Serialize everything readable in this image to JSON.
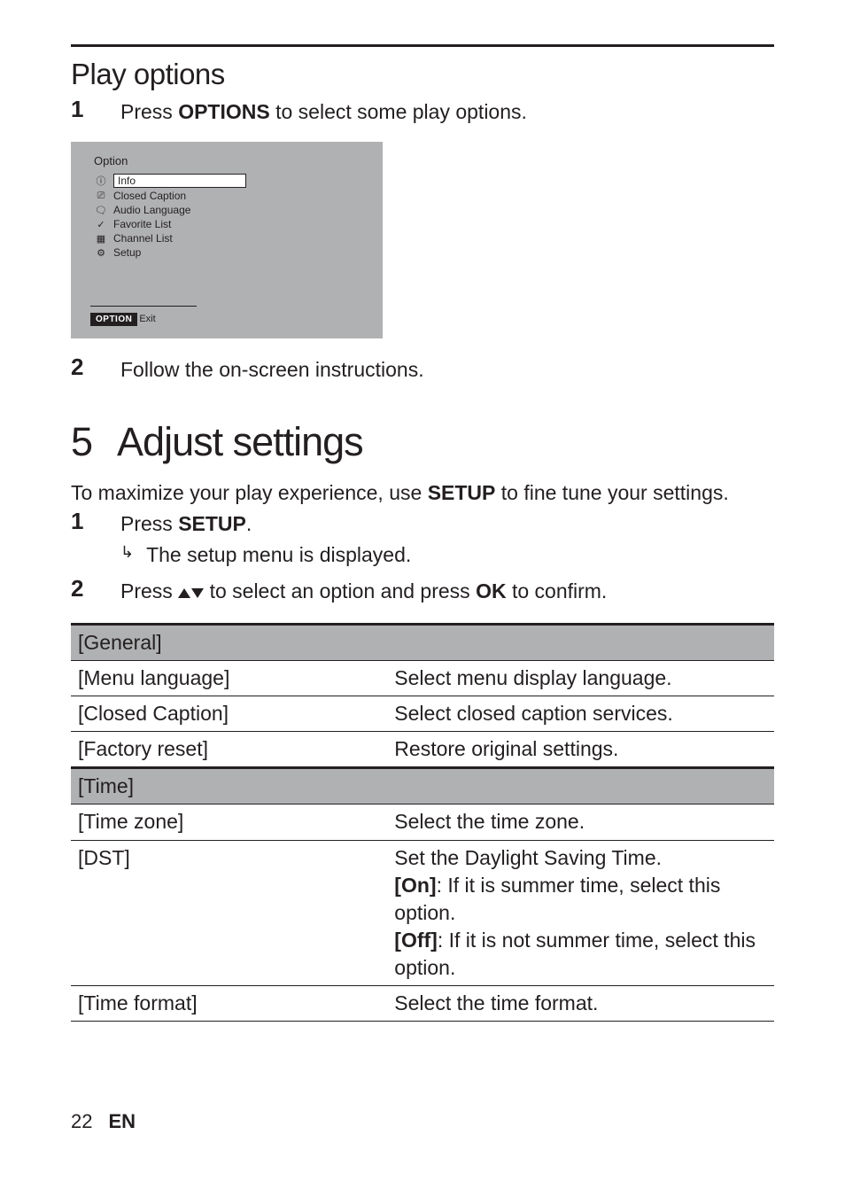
{
  "sections": {
    "play_options": {
      "heading": "Play options",
      "steps": [
        {
          "num": "1",
          "pre": "Press ",
          "bold": "OPTIONS",
          "post": " to select some play options."
        },
        {
          "num": "2",
          "pre": "Follow the on-screen instructions.",
          "bold": "",
          "post": ""
        }
      ]
    },
    "option_menu": {
      "title": "Option",
      "items": [
        {
          "icon": "ⓘ",
          "label": "Info",
          "selected": true
        },
        {
          "icon": "⎚",
          "label": "Closed Caption",
          "selected": false
        },
        {
          "icon": "🗨",
          "label": "Audio Language",
          "selected": false
        },
        {
          "icon": "✓",
          "label": "Favorite List",
          "selected": false
        },
        {
          "icon": "▦",
          "label": "Channel List",
          "selected": false
        },
        {
          "icon": "⚙",
          "label": "Setup",
          "selected": false
        }
      ],
      "button_label": "OPTION",
      "exit_label": "Exit"
    },
    "chapter": {
      "num": "5",
      "title": "Adjust settings",
      "intro_pre": "To maximize your play experience, use ",
      "intro_bold": "SETUP",
      "intro_post": " to fine tune your settings.",
      "steps": [
        {
          "num": "1",
          "pre": "Press ",
          "bold": "SETUP",
          "post": ".",
          "sub": "The setup menu is displayed."
        },
        {
          "num": "2",
          "pre": "Press ",
          "post_a": " to select an option and press ",
          "bold2": "OK",
          "post_b": " to confirm."
        }
      ]
    },
    "table": {
      "rows": [
        {
          "group": true,
          "left": "[General]",
          "right": ""
        },
        {
          "group": false,
          "left": "[Menu language]",
          "right": "Select menu display language."
        },
        {
          "group": false,
          "left": "[Closed Caption]",
          "right": "Select closed caption services."
        },
        {
          "group": false,
          "left": "[Factory reset]",
          "right": "Restore original settings."
        },
        {
          "group": true,
          "left": "[Time]",
          "right": ""
        },
        {
          "group": false,
          "left": "[Time zone]",
          "right": "Select the time zone."
        },
        {
          "group": false,
          "left": "[DST]",
          "right_dst": {
            "line1": "Set the Daylight Saving Time.",
            "on_label": "[On]",
            "on_text": ": If it is summer time, select this option.",
            "off_label": "[Off]",
            "off_text": ": If it is not summer time, select this option."
          }
        },
        {
          "group": false,
          "left": "[Time format]",
          "right": "Select the time format."
        }
      ]
    }
  },
  "footer": {
    "page": "22",
    "lang": "EN"
  }
}
